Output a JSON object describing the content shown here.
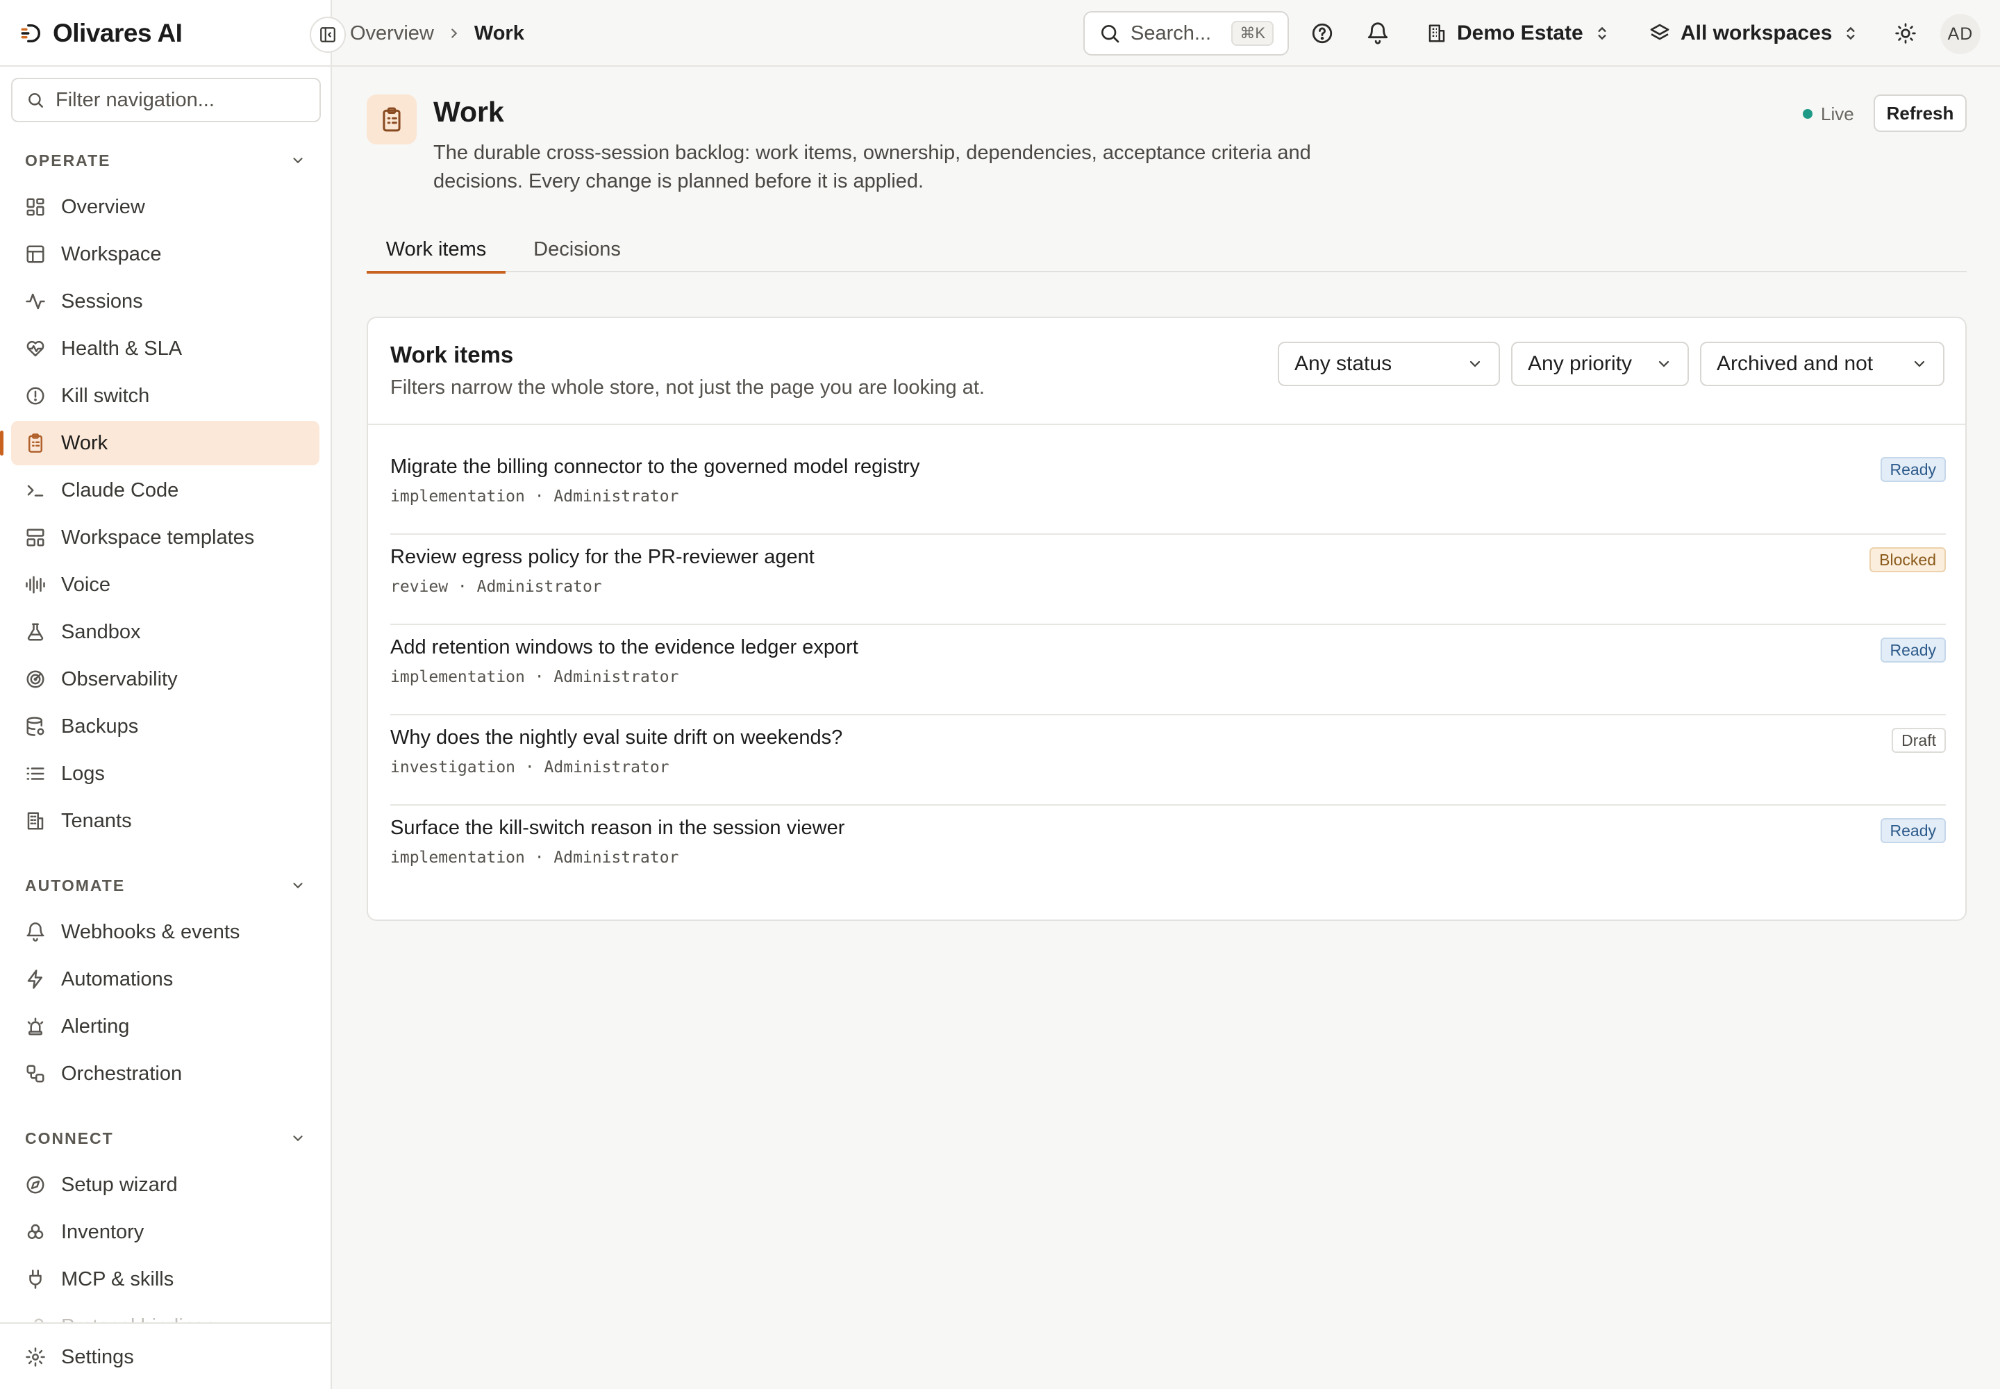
{
  "app": {
    "name": "Olivares AI"
  },
  "sidebar": {
    "filter_placeholder": "Filter navigation...",
    "sections": [
      {
        "title": "OPERATE",
        "items": [
          {
            "label": "Overview",
            "icon": "dashboard-icon"
          },
          {
            "label": "Workspace",
            "icon": "layout-icon"
          },
          {
            "label": "Sessions",
            "icon": "activity-icon"
          },
          {
            "label": "Health & SLA",
            "icon": "heart-pulse-icon"
          },
          {
            "label": "Kill switch",
            "icon": "alert-circle-icon"
          },
          {
            "label": "Work",
            "icon": "clipboard-list-icon",
            "active": true
          },
          {
            "label": "Claude Code",
            "icon": "terminal-icon"
          },
          {
            "label": "Workspace templates",
            "icon": "template-icon"
          },
          {
            "label": "Voice",
            "icon": "audio-lines-icon"
          },
          {
            "label": "Sandbox",
            "icon": "flask-icon"
          },
          {
            "label": "Observability",
            "icon": "radar-icon"
          },
          {
            "label": "Backups",
            "icon": "database-backup-icon"
          },
          {
            "label": "Logs",
            "icon": "list-icon"
          },
          {
            "label": "Tenants",
            "icon": "building-icon"
          }
        ]
      },
      {
        "title": "AUTOMATE",
        "items": [
          {
            "label": "Webhooks & events",
            "icon": "bell-icon"
          },
          {
            "label": "Automations",
            "icon": "zap-icon"
          },
          {
            "label": "Alerting",
            "icon": "siren-icon"
          },
          {
            "label": "Orchestration",
            "icon": "workflow-icon"
          }
        ]
      },
      {
        "title": "CONNECT",
        "items": [
          {
            "label": "Setup wizard",
            "icon": "compass-icon"
          },
          {
            "label": "Inventory",
            "icon": "boxes-icon"
          },
          {
            "label": "MCP & skills",
            "icon": "plug-icon"
          },
          {
            "label": "Protocol bindings",
            "icon": "link-icon",
            "faded": true
          }
        ]
      }
    ],
    "settings_label": "Settings"
  },
  "header": {
    "breadcrumb": {
      "parent": "Overview",
      "current": "Work"
    },
    "search": {
      "label": "Search...",
      "shortcut": "⌘K"
    },
    "org_switcher": "Demo Estate",
    "workspace_switcher": "All workspaces",
    "avatar_initials": "AD"
  },
  "page": {
    "title": "Work",
    "description": "The durable cross-session backlog: work items, ownership, dependencies, acceptance criteria and decisions. Every change is planned before it is applied.",
    "live_label": "Live",
    "refresh_label": "Refresh",
    "tabs": [
      {
        "label": "Work items",
        "active": true
      },
      {
        "label": "Decisions",
        "active": false
      }
    ]
  },
  "work_items": {
    "title": "Work items",
    "subtitle": "Filters narrow the whole store, not just the page you are looking at.",
    "filters": {
      "status": "Any status",
      "priority": "Any priority",
      "archived": "Archived and not"
    },
    "items": [
      {
        "title": "Migrate the billing connector to the governed model registry",
        "meta": "implementation · Administrator",
        "status": "Ready",
        "status_kind": "ready"
      },
      {
        "title": "Review egress policy for the PR-reviewer agent",
        "meta": "review · Administrator",
        "status": "Blocked",
        "status_kind": "blocked"
      },
      {
        "title": "Add retention windows to the evidence ledger export",
        "meta": "implementation · Administrator",
        "status": "Ready",
        "status_kind": "ready"
      },
      {
        "title": "Why does the nightly eval suite drift on weekends?",
        "meta": "investigation · Administrator",
        "status": "Draft",
        "status_kind": "draft"
      },
      {
        "title": "Surface the kill-switch reason in the session viewer",
        "meta": "implementation · Administrator",
        "status": "Ready",
        "status_kind": "ready"
      }
    ]
  },
  "colors": {
    "accent": "#c8621f",
    "accent_bg": "#fbe8d9",
    "live": "#1f9a86",
    "ready": "#2c5a8a",
    "blocked": "#8a5a1a"
  }
}
